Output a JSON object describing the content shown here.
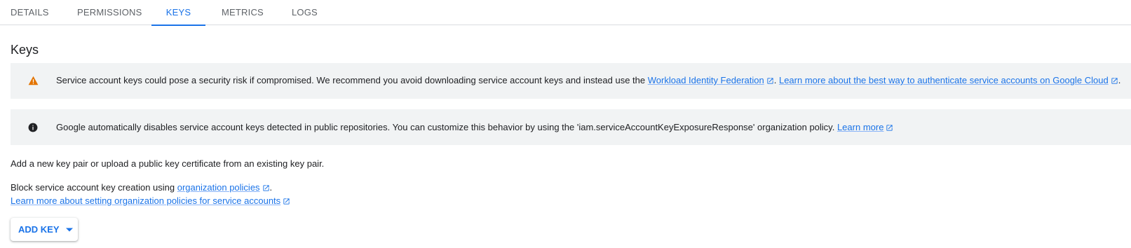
{
  "tabs": [
    {
      "label": "DETAILS",
      "active": false
    },
    {
      "label": "PERMISSIONS",
      "active": false
    },
    {
      "label": "KEYS",
      "active": true
    },
    {
      "label": "METRICS",
      "active": false
    },
    {
      "label": "LOGS",
      "active": false
    }
  ],
  "page_title": "Keys",
  "warning_banner": {
    "icon": "warning-icon",
    "text": "Service account keys could pose a security risk if compromised. We recommend you avoid downloading service account keys and instead use the",
    "link1": "Workload Identity Federation",
    "separator": ".",
    "link2": "Learn more about the best way to authenticate service accounts on Google Cloud",
    "trailing": "."
  },
  "info_banner": {
    "icon": "info-icon",
    "text": "Google automatically disables service account keys detected in public repositories. You can customize this behavior by using the 'iam.serviceAccountKeyExposureResponse' organization policy.",
    "link": "Learn more"
  },
  "description": "Add a new key pair or upload a public key certificate from an existing key pair.",
  "policy_text": "Block service account key creation using",
  "policy_link": "organization policies",
  "policy_trailing": ".",
  "learn_more_policies": "Learn more about setting organization policies for service accounts",
  "add_key_button": "ADD KEY",
  "colors": {
    "accent": "#1a73e8",
    "warning": "#e37400",
    "banner_bg": "#f1f3f4"
  }
}
